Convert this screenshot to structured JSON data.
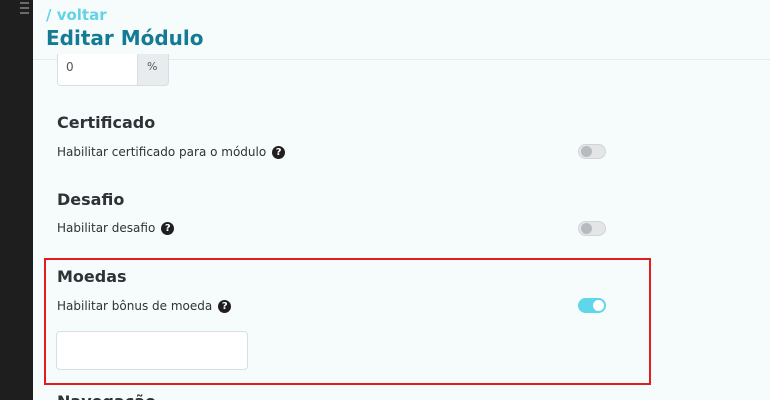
{
  "nav": {
    "back_label": "/ voltar",
    "page_title": "Editar Módulo"
  },
  "stepper": {
    "value": "0",
    "addon_label": "%"
  },
  "sections": {
    "certificate": {
      "title": "Certificado",
      "setting_label": "Habilitar certificado para o módulo",
      "enabled": false
    },
    "challenge": {
      "title": "Desafio",
      "setting_label": "Habilitar desafio",
      "enabled": false
    },
    "coins": {
      "title": "Moedas",
      "setting_label": "Habilitar bônus de moeda",
      "enabled": true,
      "amount_value": ""
    },
    "next": {
      "title": "Navegação"
    }
  },
  "icons": {
    "help": "question-circle-icon"
  },
  "colors": {
    "accent": "#5fd6ea",
    "title": "#157a93",
    "highlight": "#e01e22"
  }
}
